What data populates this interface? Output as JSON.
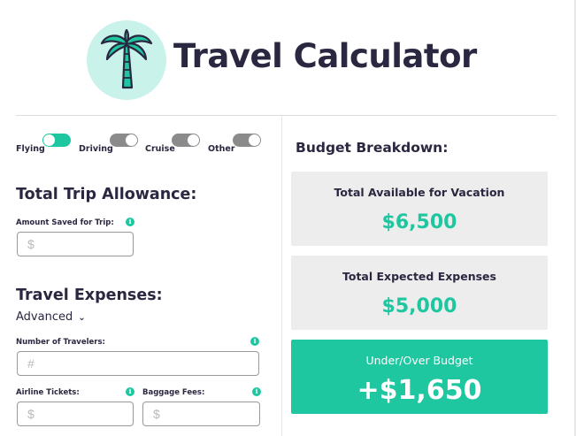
{
  "header": {
    "title": "Travel Calculator",
    "logo_icon": "palm-tree-icon"
  },
  "modes": [
    {
      "label": "Flying",
      "on": true
    },
    {
      "label": "Driving",
      "on": false
    },
    {
      "label": "Cruise",
      "on": false
    },
    {
      "label": "Other",
      "on": false
    }
  ],
  "allowance": {
    "title": "Total Trip Allowance:",
    "amount_label": "Amount Saved for Trip:",
    "amount_placeholder": "$"
  },
  "expenses": {
    "title": "Travel Expenses:",
    "mode_select": "Advanced",
    "travelers_label": "Number of Travelers:",
    "travelers_placeholder": "#",
    "airline_label": "Airline Tickets:",
    "airline_placeholder": "$",
    "baggage_label": "Baggage Fees:",
    "baggage_placeholder": "$"
  },
  "breakdown": {
    "title": "Budget Breakdown:",
    "available_label": "Total Available for Vacation",
    "available_value": "$6,500",
    "expenses_label": "Total Expected Expenses",
    "expenses_value": "$5,000",
    "result_label": "Under/Over Budget",
    "result_value": "+$1,650"
  },
  "colors": {
    "accent": "#1ec7a0",
    "text": "#2a2740",
    "logo_bg": "#c9f2ea",
    "toggle_off": "#8b8b8b"
  }
}
